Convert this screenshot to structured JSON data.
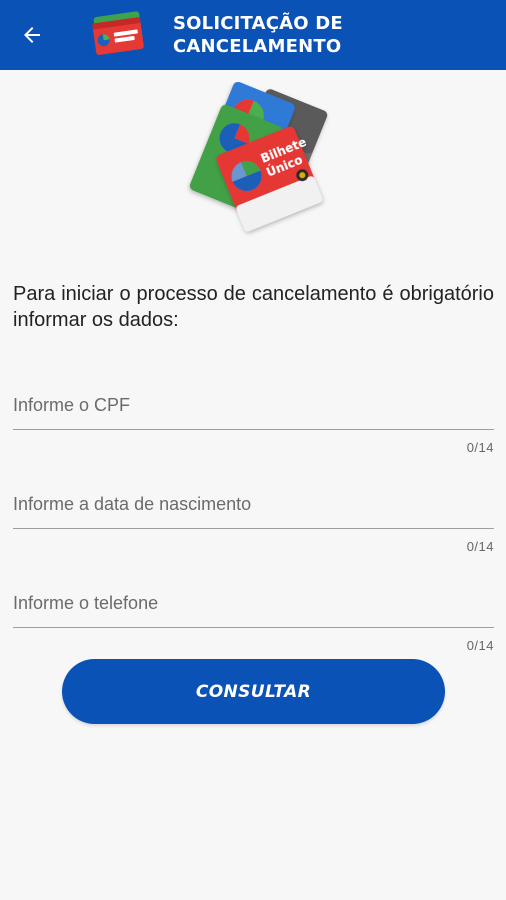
{
  "header": {
    "title_line1": "SOLICITAÇÃO DE",
    "title_line2": "CANCELAMENTO",
    "back_icon": "arrow-left-icon",
    "brand_color": "#0a52b5"
  },
  "hero": {
    "card_text_line1": "Bilhete",
    "card_text_line2": "Único",
    "icon": "bilhete-unico-cards-illustration"
  },
  "intro_text": "Para iniciar o processo de cancelamento é obrigatório informar os dados:",
  "fields": [
    {
      "placeholder": "Informe o CPF",
      "value": "",
      "counter": "0/14"
    },
    {
      "placeholder": "Informe a data de nascimento",
      "value": "",
      "counter": "0/14"
    },
    {
      "placeholder": "Informe o telefone",
      "value": "",
      "counter": "0/14"
    }
  ],
  "consult_button": {
    "label": "CONSULTAR"
  }
}
